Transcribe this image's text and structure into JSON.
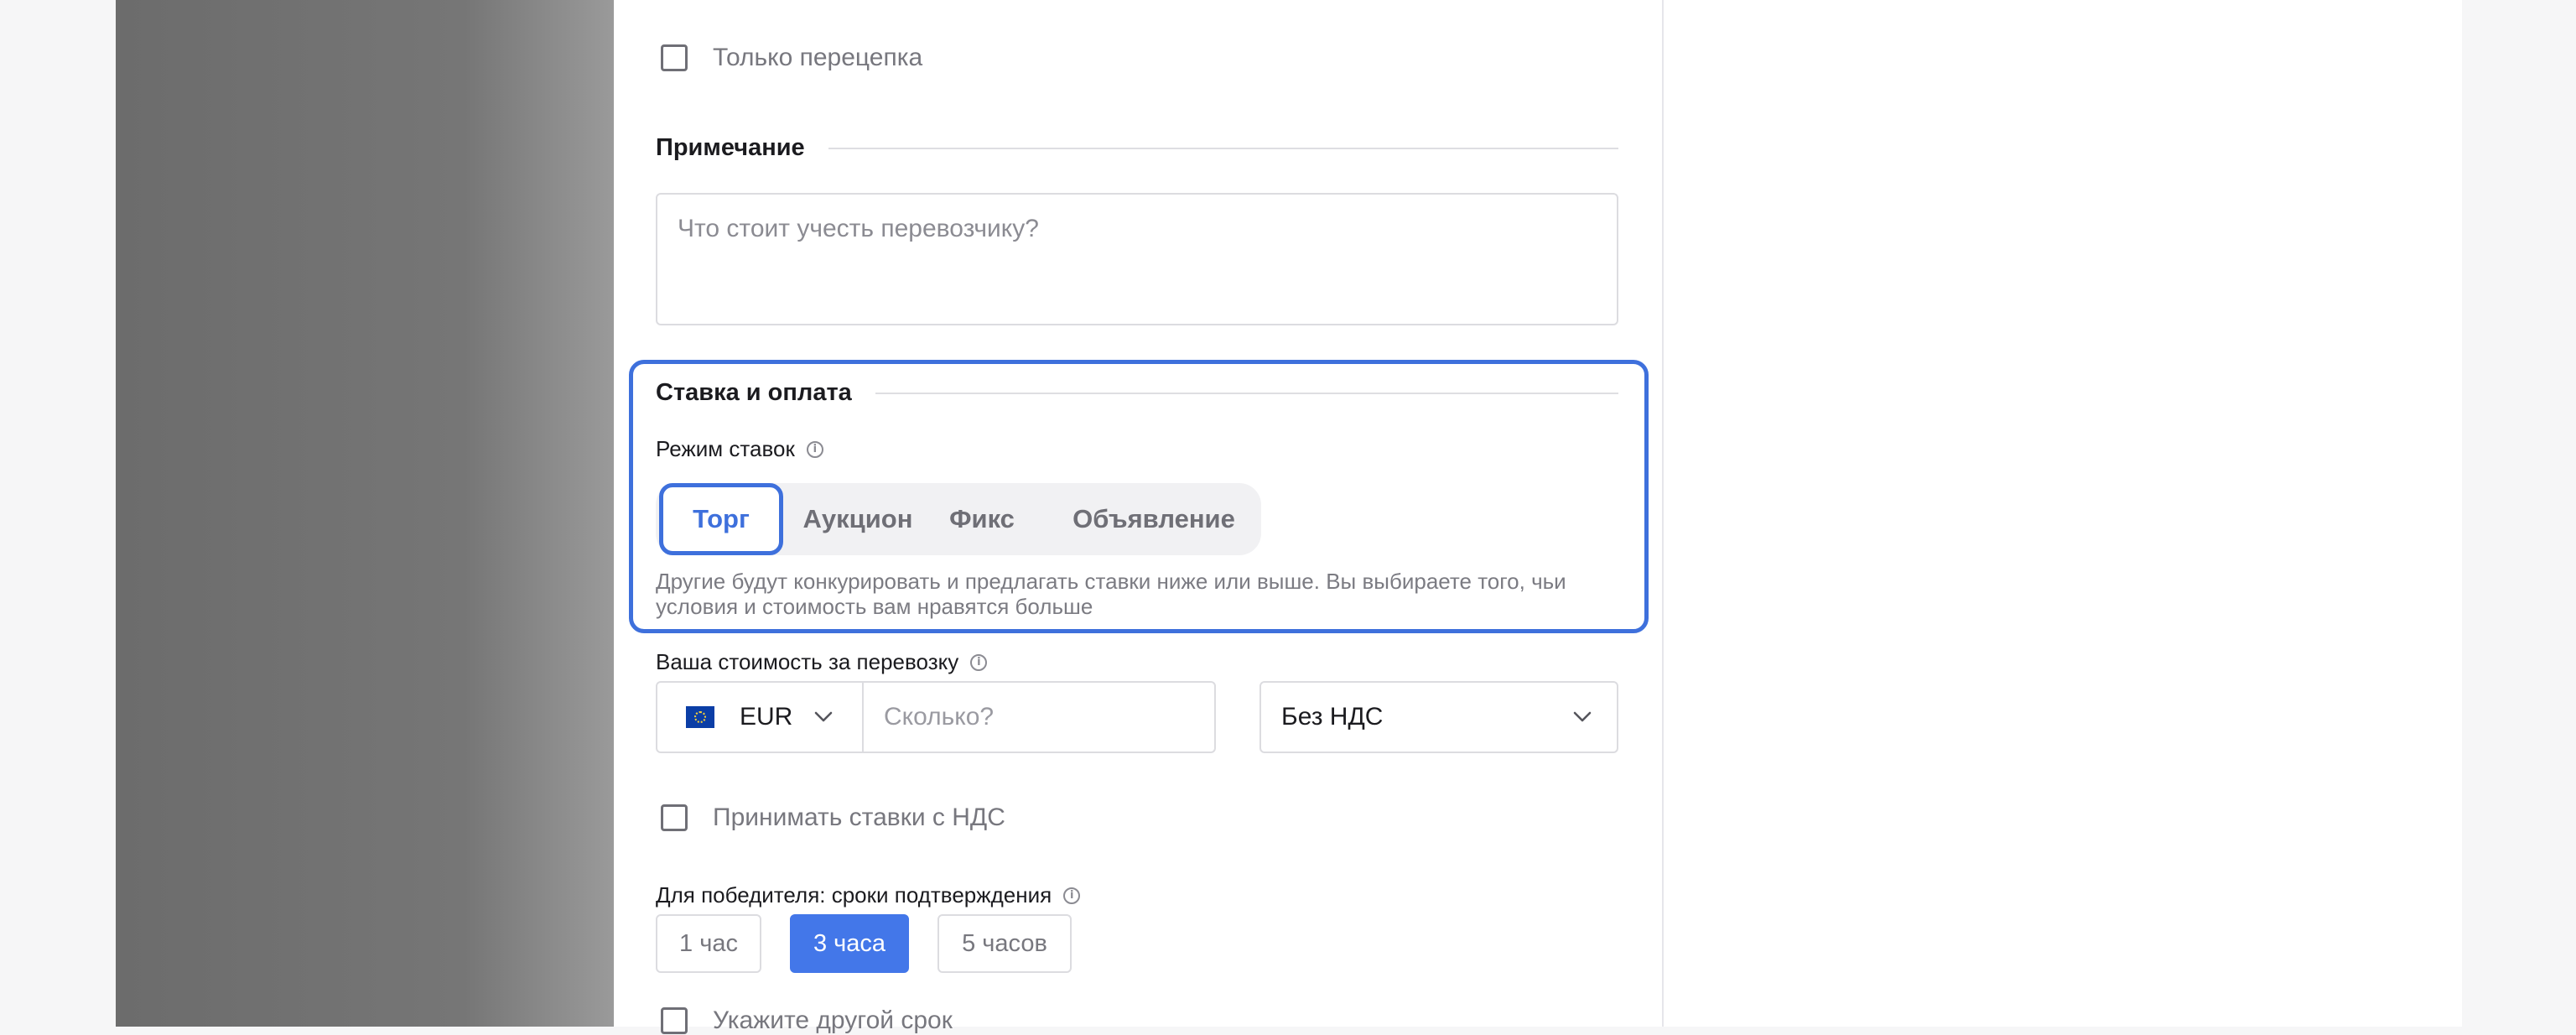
{
  "checkbox_reload": {
    "label": "Только перецепка"
  },
  "note": {
    "title": "Примечание",
    "placeholder": "Что стоит учесть перевозчику?"
  },
  "rate": {
    "title": "Ставка и оплата",
    "mode_label": "Режим ставок",
    "modes": [
      "Торг",
      "Аукцион",
      "Фикс",
      "Объявление"
    ],
    "active_mode": "Торг",
    "hint": "Другие будут конкурировать и предлагать ставки ниже или выше. Вы выбираете того, чьи условия и стоимость вам нравятся больше"
  },
  "price": {
    "label": "Ваша стоимость за перевозку",
    "currency": "EUR",
    "amount_placeholder": "Сколько?",
    "vat": "Без НДС"
  },
  "accept_vat": {
    "label": "Принимать ставки с НДС"
  },
  "winner": {
    "label": "Для победителя: сроки подтверждения",
    "options": [
      "1 час",
      "3 часа",
      "5 часов"
    ],
    "active": "3 часа"
  },
  "other_term": {
    "label": "Укажите другой срок"
  },
  "colors": {
    "accent": "#3e70dc",
    "active_pill": "#4377e9",
    "backdrop": "#767676"
  },
  "icons": {
    "info": "info-icon",
    "chevron": "chevron-down-icon",
    "flag": "eu-flag-icon"
  }
}
